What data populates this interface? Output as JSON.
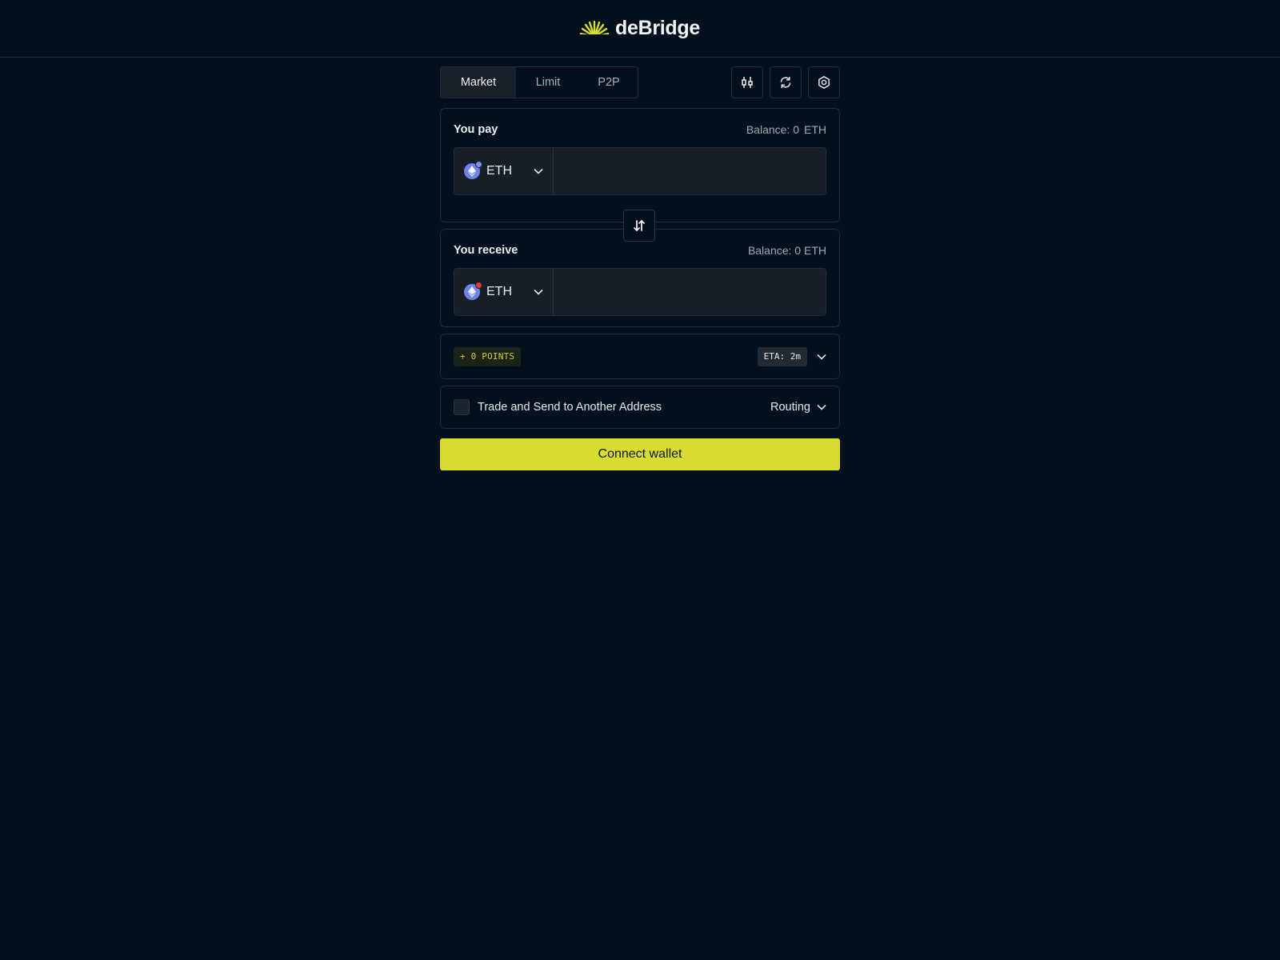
{
  "header": {
    "brand": "deBridge"
  },
  "tabs": [
    {
      "label": "Market",
      "active": true
    },
    {
      "label": "Limit",
      "active": false
    },
    {
      "label": "P2P",
      "active": false
    }
  ],
  "toolbar_icons": [
    "chart-settings-icon",
    "refresh-icon",
    "gear-icon"
  ],
  "pay": {
    "title": "You pay",
    "balance_label": "Balance: 0",
    "balance_symbol": "ETH",
    "token": "ETH",
    "amount": "",
    "chain_badge_color": "#7b8ff0"
  },
  "receive": {
    "title": "You receive",
    "balance_label": "Balance: 0 ETH",
    "token": "ETH",
    "amount": "",
    "chain_badge_color": "#e23b3b"
  },
  "points": {
    "label": "+ 0 POINTS"
  },
  "eta": {
    "label": "ETA: 2m"
  },
  "address": {
    "label": "Trade and Send to Another Address",
    "checked": false
  },
  "routing": {
    "label": "Routing"
  },
  "connect": {
    "label": "Connect wallet"
  },
  "colors": {
    "background": "#01101c",
    "accent": "#d8dc30",
    "token_blue": "#6c84e8"
  }
}
